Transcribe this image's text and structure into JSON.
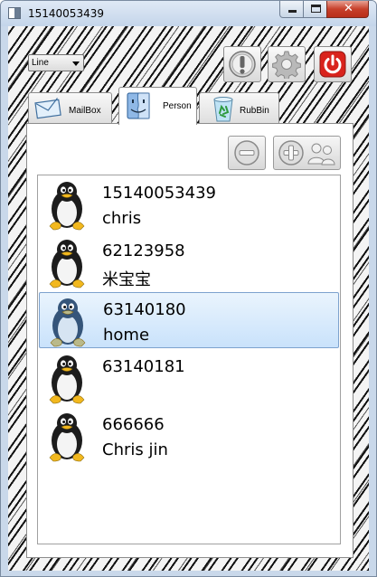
{
  "window": {
    "title": "15140053439"
  },
  "toolbar": {
    "mode_value": "Line"
  },
  "tabs": [
    {
      "label": "MailBox"
    },
    {
      "label": "Person"
    },
    {
      "label": "RubBin"
    }
  ],
  "tabs_selected": "Person",
  "contacts": [
    {
      "number": "15140053439",
      "name": "chris"
    },
    {
      "number": "62123958",
      "name": "米宝宝"
    },
    {
      "number": "63140180",
      "name": "home",
      "selected": true
    },
    {
      "number": "63140181",
      "name": ""
    },
    {
      "number": "666666",
      "name": "Chris jin"
    }
  ],
  "icons": {
    "app": "app-window-icon",
    "info": "warning-exclamation-icon",
    "settings": "gear-icon",
    "power": "power-icon",
    "mailbox": "envelope-icon",
    "person": "finder-face-icon",
    "rubbin": "recycle-bin-icon",
    "remove": "remove-minus-icon",
    "add": "add-users-icon",
    "avatar": "penguin-icon"
  },
  "colors": {
    "power_red": "#d9231c",
    "selection": "#cce4fb",
    "titlebar": "#c9d8ea"
  }
}
